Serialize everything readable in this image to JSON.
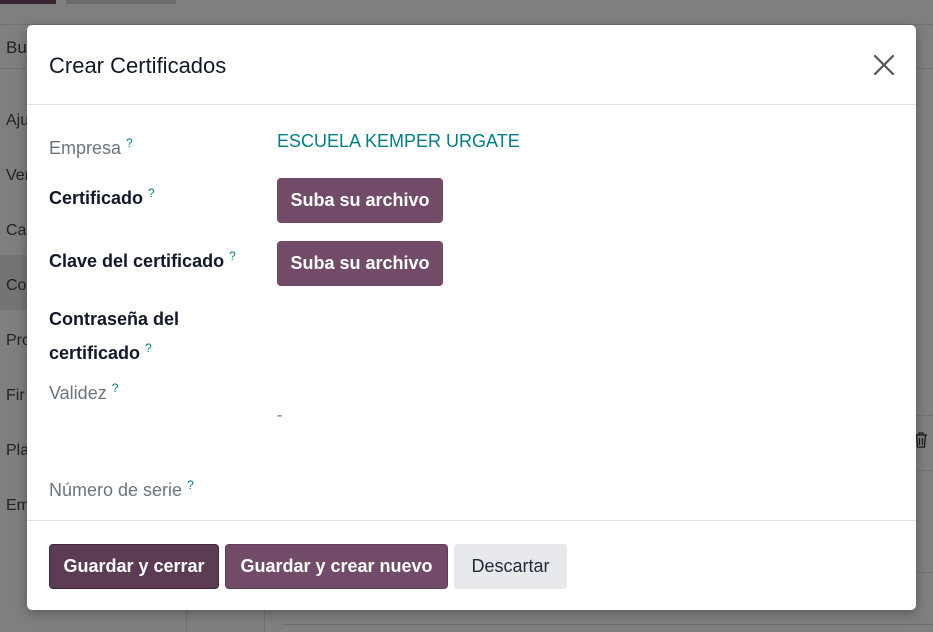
{
  "background": {
    "search_text": "Bu",
    "sidebar_items": [
      "Aju",
      "Ven",
      "Cal",
      "Co",
      "Pro",
      "Fir",
      "Pla",
      "Em"
    ]
  },
  "modal": {
    "title": "Crear Certificados",
    "fields": {
      "empresa": {
        "label": "Empresa",
        "help": "?",
        "value": "ESCUELA KEMPER URGATE"
      },
      "certificado": {
        "label": "Certificado",
        "help": "?",
        "button": "Suba su archivo"
      },
      "clave": {
        "label": "Clave del certificado",
        "help": "?",
        "button": "Suba su archivo"
      },
      "contrasena": {
        "label_line1": "Contraseña del",
        "label_line2": "certificado",
        "help": "?"
      },
      "validez": {
        "label": "Validez",
        "help": "?",
        "value": "-"
      },
      "numero_serie": {
        "label": "Número de serie",
        "help": "?"
      }
    },
    "footer": {
      "save_close": "Guardar y cerrar",
      "save_new": "Guardar y crear nuevo",
      "discard": "Descartar"
    }
  },
  "colors": {
    "primary": "#714b67",
    "link": "#017e84"
  },
  "icons": {
    "close": "close-icon",
    "trash": "trash-icon"
  }
}
